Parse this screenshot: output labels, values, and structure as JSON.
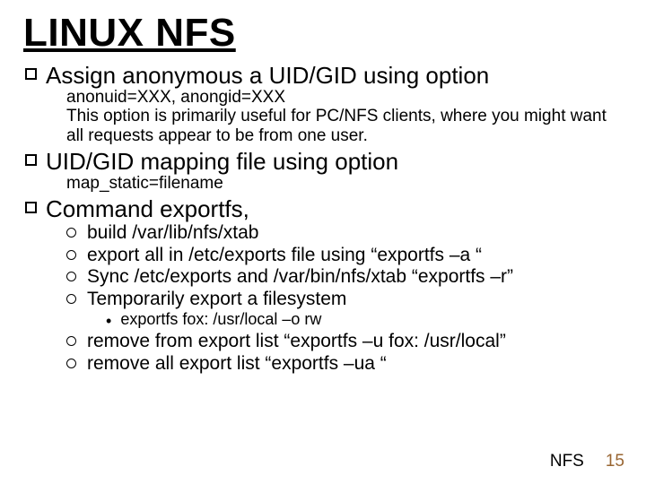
{
  "title": "LINUX NFS",
  "bullets": {
    "b1": {
      "text": "Assign anonymous a UID/GID using option",
      "sub1": "anonuid=XXX, anongid=XXX",
      "sub2": "This option is primarily useful for PC/NFS clients, where you might want all requests appear to be from one user."
    },
    "b2": {
      "text": "UID/GID mapping file using option",
      "sub1": "map_static=filename"
    },
    "b3": {
      "text": "Command exportfs,",
      "items": {
        "i1": "build /var/lib/nfs/xtab",
        "i2": "export all in /etc/exports file using “exportfs –a “",
        "i3": "Sync /etc/exports and /var/bin/nfs/xtab “exportfs –r”",
        "i4": "Temporarily export a filesystem",
        "i4sub": "exportfs fox: /usr/local –o rw",
        "i5": "remove from export list “exportfs –u fox: /usr/local”",
        "i6": "remove all export list “exportfs –ua “"
      }
    }
  },
  "footer": {
    "label": "NFS",
    "page": "15"
  }
}
